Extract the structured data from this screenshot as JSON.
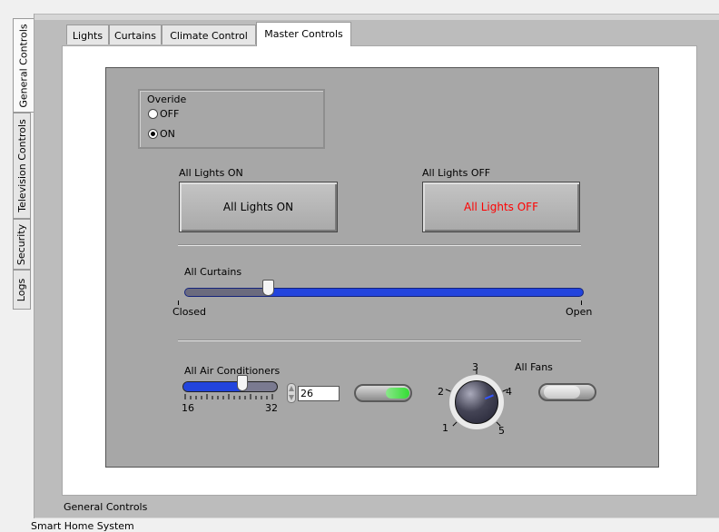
{
  "app": {
    "window_title": "Smart Home System"
  },
  "vertical_tabs": [
    {
      "label": "General Controls",
      "active": true
    },
    {
      "label": "Television Controls",
      "active": false
    },
    {
      "label": "Security",
      "active": false
    },
    {
      "label": "Logs",
      "active": false
    }
  ],
  "tabs": [
    {
      "label": "Lights",
      "active": false
    },
    {
      "label": "Curtains",
      "active": false
    },
    {
      "label": "Climate Control",
      "active": false
    },
    {
      "label": "Master Controls",
      "active": true
    }
  ],
  "override": {
    "label": "Overide",
    "options": [
      "OFF",
      "ON"
    ],
    "selected": "ON"
  },
  "lights": {
    "on_label": "All Lights ON",
    "on_button": "All Lights ON",
    "off_label": "All Lights OFF",
    "off_button": "All Lights OFF",
    "off_button_color": "#ff0000"
  },
  "curtains": {
    "label": "All Curtains",
    "min_label": "Closed",
    "max_label": "Open",
    "level_fraction": 0.21
  },
  "air_conditioners": {
    "label": "All Air Conditioners",
    "min": "16",
    "max": "32",
    "value": "26",
    "power_on": true,
    "led_color": "#33dd33"
  },
  "fans": {
    "label": "All Fans",
    "knob_scale": [
      "1",
      "2",
      "3",
      "4",
      "5"
    ],
    "knob_value": 4,
    "power_on": false
  },
  "footer": {
    "tab_caption": "General Controls"
  },
  "colors": {
    "slider_blue": "#2244dd",
    "panel_gray": "#a7a7a7"
  }
}
